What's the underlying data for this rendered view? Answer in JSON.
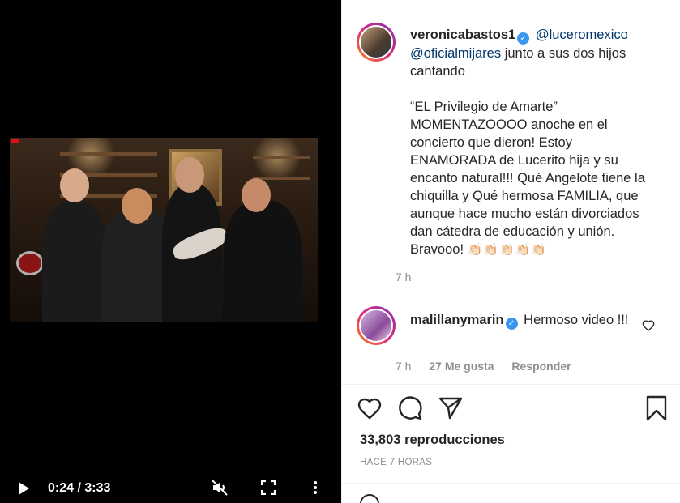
{
  "video": {
    "time_display": "0:24 / 3:33",
    "icons": [
      "play-icon",
      "mute-icon",
      "fullscreen-icon",
      "more-icon"
    ]
  },
  "caption": {
    "username": "veronicabastos1",
    "mention1": "@luceromexico",
    "mention2": "@oficialmijares",
    "line1_rest": " junto a sus dos hijos cantando",
    "paragraph2": "“EL Privilegio de Amarte” MOMENTAZOOOO anoche en el concierto que dieron! Estoy ENAMORADA de Lucerito hija y su encanto natural!!! Qué Angelote tiene la chiquilla y Qué hermosa FAMILIA, que aunque hace mucho están divorciados dan cátedra de educación y unión. Bravooo!",
    "emoji": "👏🏻👏🏻👏🏻👏🏻👏🏻",
    "time": "7 h"
  },
  "comment": {
    "username": "malillanymarin",
    "text": "Hermoso video !!!",
    "time": "7 h",
    "likes": "27 Me gusta",
    "reply": "Responder"
  },
  "post": {
    "views_count": "33,803",
    "views_label": "reproducciones",
    "ago": "HACE 7 HORAS"
  },
  "colors": {
    "verified": "#3897f0",
    "mention": "#00376b",
    "muted": "#8e8e8e",
    "text": "#262626"
  }
}
